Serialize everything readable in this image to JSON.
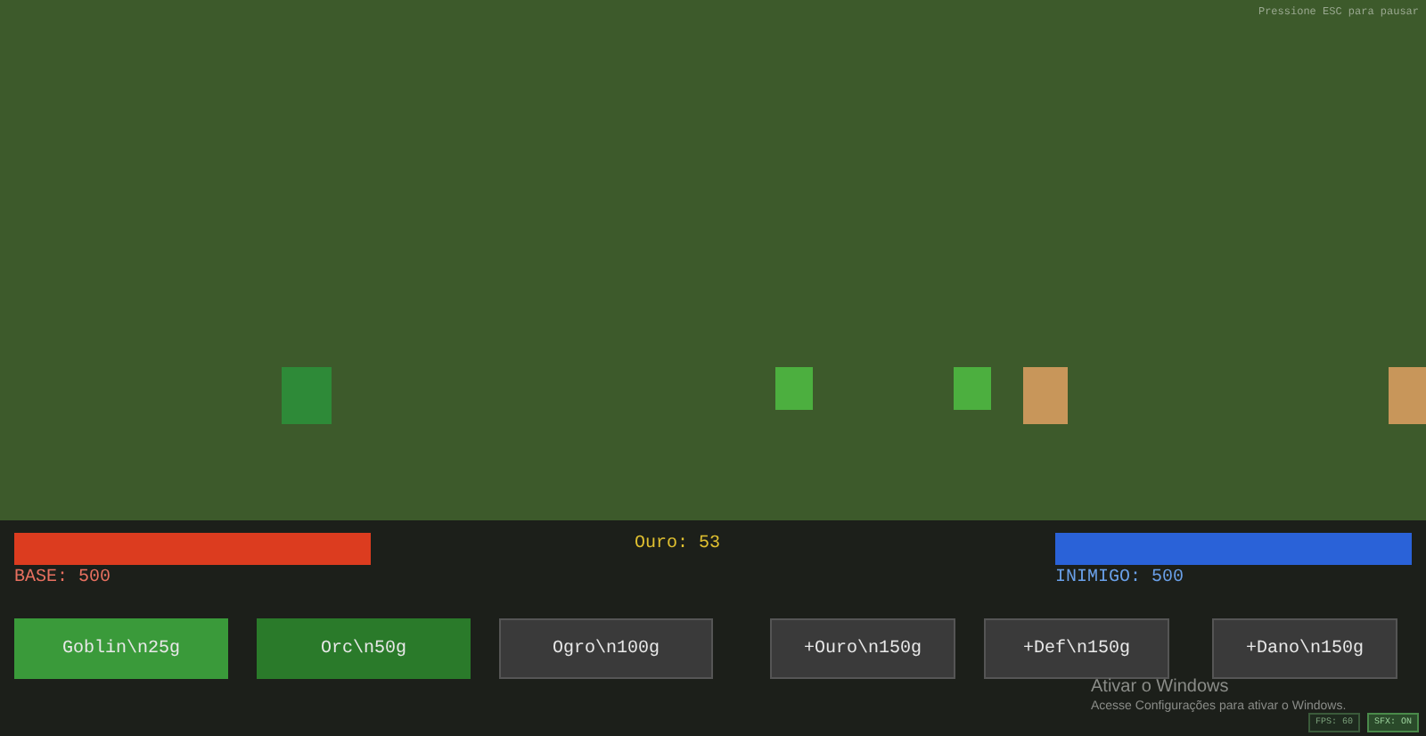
{
  "hint": "Pressione ESC para pausar",
  "units": [
    {
      "kind": "orc"
    },
    {
      "kind": "goblin"
    },
    {
      "kind": "goblin"
    },
    {
      "kind": "enemy"
    },
    {
      "kind": "enemy"
    }
  ],
  "base": {
    "label": "BASE: 500",
    "level": 1
  },
  "gold": "Ouro: 53",
  "enemy": {
    "label": "INIMIGO: 500",
    "level": 1
  },
  "unit_buttons": [
    {
      "label": "Goblin\\n25g",
      "disabled": false,
      "selected": false
    },
    {
      "label": "Orc\\n50g",
      "disabled": false,
      "selected": true
    },
    {
      "label": "Ogro\\n100g",
      "disabled": true,
      "selected": false
    }
  ],
  "upgrade_buttons": [
    {
      "label": "+Ouro\\n150g",
      "disabled": true
    },
    {
      "label": "+Def\\n150g",
      "disabled": true
    },
    {
      "label": "+Dano\\n150g",
      "disabled": true
    }
  ],
  "os_notice": {
    "title": "Ativar o Windows",
    "text": "Acesse Configurações para ativar o Windows."
  },
  "badges": [
    {
      "label": "FPS: 60",
      "on": false
    },
    {
      "label": "SFX: ON",
      "on": true
    }
  ]
}
